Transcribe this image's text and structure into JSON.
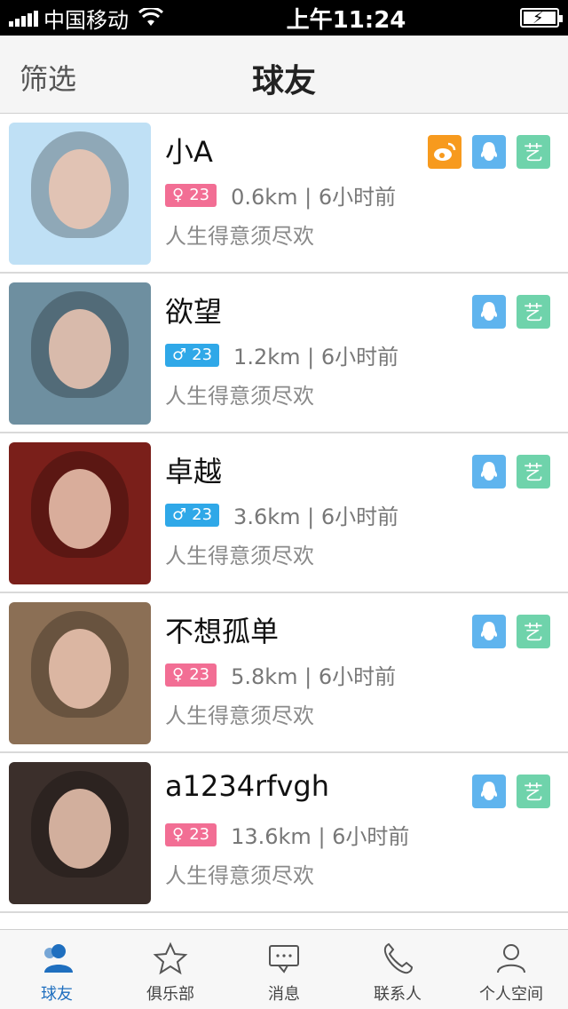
{
  "status_bar": {
    "carrier": "中国移动",
    "time": "上午11:24"
  },
  "nav": {
    "left_action": "筛选",
    "title": "球友"
  },
  "users": [
    {
      "name": "小A",
      "gender": "female",
      "age": "23",
      "distance": "0.6km | 6小时前",
      "motto": "人生得意须尽欢",
      "icons": [
        "weibo",
        "qq",
        "yi"
      ],
      "avatar_color": "#bfe0f5"
    },
    {
      "name": "欲望",
      "gender": "male",
      "age": "23",
      "distance": "1.2km | 6小时前",
      "motto": "人生得意须尽欢",
      "icons": [
        "qq",
        "yi"
      ],
      "avatar_color": "#6e8fa0"
    },
    {
      "name": "卓越",
      "gender": "male",
      "age": "23",
      "distance": "3.6km | 6小时前",
      "motto": "人生得意须尽欢",
      "icons": [
        "qq",
        "yi"
      ],
      "avatar_color": "#7a1f1a"
    },
    {
      "name": "不想孤单",
      "gender": "female",
      "age": "23",
      "distance": "5.8km | 6小时前",
      "motto": "人生得意须尽欢",
      "icons": [
        "qq",
        "yi"
      ],
      "avatar_color": "#8b6f55"
    },
    {
      "name": "a1234rfvgh",
      "gender": "female",
      "age": "23",
      "distance": "13.6km | 6小时前",
      "motto": "人生得意须尽欢",
      "icons": [
        "qq",
        "yi"
      ],
      "avatar_color": "#3b2f2b"
    }
  ],
  "icon_labels": {
    "yi": "艺"
  },
  "tabs": [
    {
      "label": "球友",
      "icon": "user-icon",
      "active": true
    },
    {
      "label": "俱乐部",
      "icon": "star-icon",
      "active": false
    },
    {
      "label": "消息",
      "icon": "message-icon",
      "active": false
    },
    {
      "label": "联系人",
      "icon": "phone-icon",
      "active": false
    },
    {
      "label": "个人空间",
      "icon": "profile-icon",
      "active": false
    }
  ],
  "colors": {
    "female_badge": "#f26e94",
    "male_badge": "#2fa8e8",
    "weibo": "#f79a1e",
    "qq": "#5fb4ee",
    "yi": "#6fd3ab",
    "tab_active": "#1f6fbf"
  }
}
